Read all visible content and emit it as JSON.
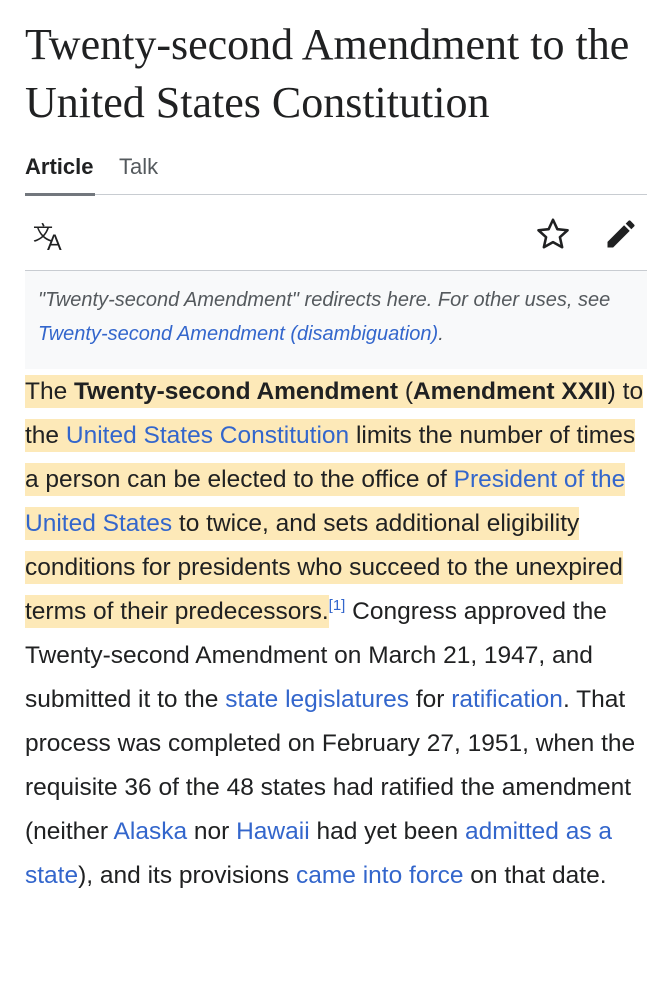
{
  "page": {
    "title": "Twenty-second Amendment to the United States Constitution"
  },
  "tabs": [
    {
      "label": "Article",
      "active": true
    },
    {
      "label": "Talk",
      "active": false
    }
  ],
  "toolbar": {
    "icons": [
      "language-icon",
      "star-icon",
      "edit-pencil-icon"
    ]
  },
  "hatnote": {
    "prefix": "\"Twenty-second Amendment\" redirects here. For other uses, see ",
    "link": "Twenty-second Amendment (disambiguation)",
    "suffix": "."
  },
  "paragraph": {
    "s1": "The ",
    "s2": "Twenty-second Amendment",
    "s3": " (",
    "s4": "Amendment XXII",
    "s5": ") to the ",
    "link_constitution": "United States Constitution",
    "s6": " limits the number of times a person can be elected to the office of ",
    "link_president": "President of the United States",
    "s7": " to twice, and sets additional eligibility conditions for presidents who succeed to the unexpired terms of their predecessors.",
    "citation": "[1]",
    "s8": " Congress approved the Twenty-second Amendment on March 21, 1947, and submitted it to the ",
    "link_legislatures": "state legislatures",
    "s9": " for ",
    "link_ratification": "ratification",
    "s10": ". That process was completed on February 27, 1951, when the requisite 36 of the 48 states had ratified the amendment (neither ",
    "link_alaska": "Alaska",
    "s11": " nor ",
    "link_hawaii": "Hawaii",
    "s12": " had yet been ",
    "link_admitted": "admitted as a state",
    "s13": "), and its provisions ",
    "link_force": "came into force",
    "s14": " on that date."
  },
  "colors": {
    "link": "#3366cc",
    "highlight": "#fde9b8",
    "hatnote_bg": "#f8f9fa",
    "text": "#202122"
  }
}
